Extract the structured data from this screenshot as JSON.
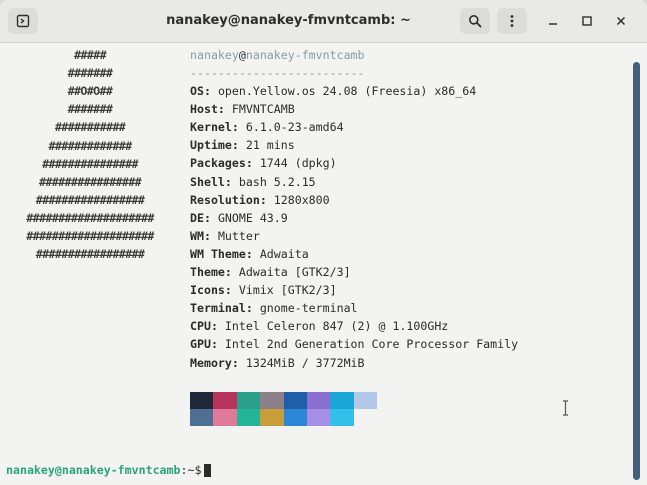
{
  "window": {
    "title": "nanakey@nanakey-fmvntcamb: ~",
    "icons": {
      "new_tab": "terminal-new-tab-icon",
      "search": "search-icon",
      "menu": "kebab-menu-icon",
      "minimize": "minimize-icon",
      "maximize": "maximize-icon",
      "close": "close-icon"
    }
  },
  "logo": [
    "#####",
    "#######",
    "##O#O##",
    "#######",
    "###########",
    "#############",
    "###############",
    "################",
    "#################",
    "####################",
    "####################",
    "#################"
  ],
  "info": {
    "header_user": "nanakey",
    "header_at": "@",
    "header_host": "nanakey-fmvntcamb",
    "separator": "-------------------------",
    "rows": [
      {
        "key": "OS",
        "value": "open.Yellow.os 24.08 (Freesia) x86_64"
      },
      {
        "key": "Host",
        "value": "FMVNTCAMB"
      },
      {
        "key": "Kernel",
        "value": "6.1.0-23-amd64"
      },
      {
        "key": "Uptime",
        "value": "21 mins"
      },
      {
        "key": "Packages",
        "value": "1744 (dpkg)"
      },
      {
        "key": "Shell",
        "value": "bash 5.2.15"
      },
      {
        "key": "Resolution",
        "value": "1280x800"
      },
      {
        "key": "DE",
        "value": "GNOME 43.9"
      },
      {
        "key": "WM",
        "value": "Mutter"
      },
      {
        "key": "WM Theme",
        "value": "Adwaita"
      },
      {
        "key": "Theme",
        "value": "Adwaita [GTK2/3]"
      },
      {
        "key": "Icons",
        "value": "Vimix [GTK2/3]"
      },
      {
        "key": "Terminal",
        "value": "gnome-terminal"
      },
      {
        "key": "CPU",
        "value": "Intel Celeron 847 (2) @ 1.100GHz"
      },
      {
        "key": "GPU",
        "value": "Intel 2nd Generation Core Processor Family"
      },
      {
        "key": "Memory",
        "value": "1324MiB / 3772MiB"
      }
    ]
  },
  "palette": {
    "top": [
      "#1e2a3a",
      "#b8345a",
      "#2aa08a",
      "#8c7f8a",
      "#1f5ea8",
      "#8a6fd0",
      "#1aa6d6",
      "#b4c9ea"
    ],
    "bottom": [
      "#4e6f93",
      "#e07a9a",
      "#23b597",
      "#c99d3a",
      "#2e86d6",
      "#a78fe8",
      "#33c0e8",
      "#f3f3f2"
    ]
  },
  "prompt": {
    "user_host": "nanakey@nanakey-fmvntcamb",
    "path": ":~$"
  },
  "colors": {
    "accent_prompt": "#2aa37a",
    "scrollbar": "#44607c",
    "background": "#f3f3f2"
  }
}
